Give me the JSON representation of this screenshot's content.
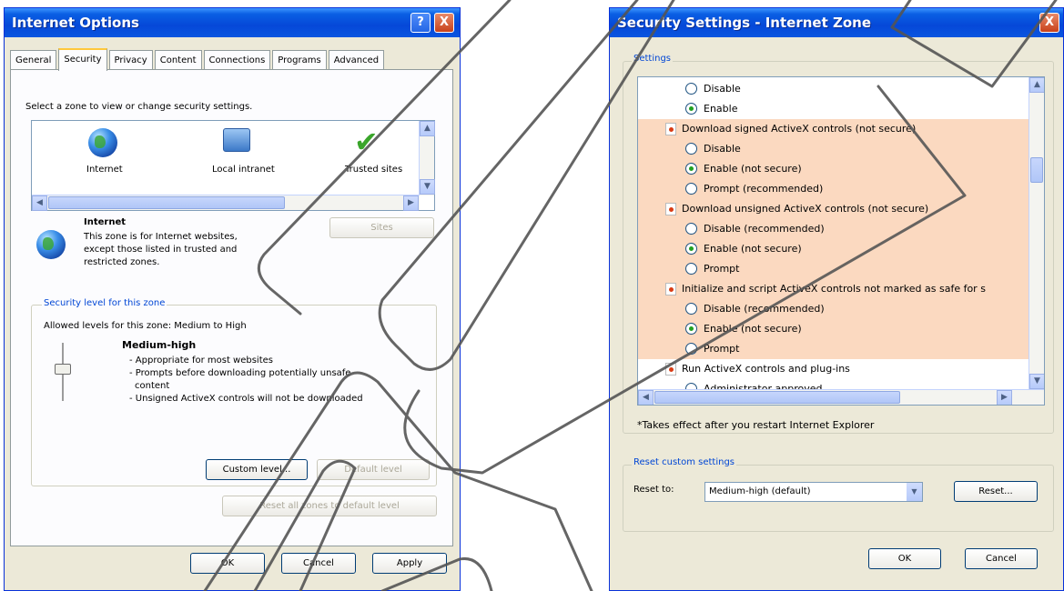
{
  "left_window": {
    "title": "Internet Options",
    "help_glyph": "?",
    "close_glyph": "X",
    "tabs": [
      "General",
      "Security",
      "Privacy",
      "Content",
      "Connections",
      "Programs",
      "Advanced"
    ],
    "active_tab": "Security",
    "zone_prompt": "Select a zone to view or change security settings.",
    "zones": [
      {
        "label": "Internet",
        "icon": "globe-icon"
      },
      {
        "label": "Local intranet",
        "icon": "computer-globe-icon"
      },
      {
        "label": "Trusted sites",
        "icon": "checkmark-icon"
      }
    ],
    "selected_zone_title": "Internet",
    "selected_zone_desc": [
      "This zone is for Internet websites,",
      "except those listed in trusted and",
      "restricted zones."
    ],
    "sites_button": "Sites",
    "level_group_label": "Security level for this zone",
    "allowed_levels": "Allowed levels for this zone: Medium to High",
    "level_name": "Medium-high",
    "level_desc": [
      "- Appropriate for most websites",
      "- Prompts before downloading potentially unsafe",
      "content",
      "- Unsigned ActiveX controls will not be downloaded"
    ],
    "custom_level_button": "Custom level...",
    "default_level_button": "Default level",
    "reset_all_button": "Reset all zones to default level",
    "ok_button": "OK",
    "cancel_button": "Cancel",
    "apply_button": "Apply"
  },
  "right_window": {
    "title": "Security Settings - Internet Zone",
    "close_glyph": "X",
    "settings_label": "Settings",
    "settings_rows": [
      {
        "type": "radio",
        "label": "Disable",
        "checked": false,
        "hl": false
      },
      {
        "type": "radio",
        "label": "Enable",
        "checked": true,
        "hl": false
      },
      {
        "type": "header",
        "label": "Download signed ActiveX controls (not secure)",
        "hl": true
      },
      {
        "type": "radio",
        "label": "Disable",
        "checked": false,
        "hl": true
      },
      {
        "type": "radio",
        "label": "Enable (not secure)",
        "checked": true,
        "hl": true
      },
      {
        "type": "radio",
        "label": "Prompt (recommended)",
        "checked": false,
        "hl": true
      },
      {
        "type": "header",
        "label": "Download unsigned ActiveX controls (not secure)",
        "hl": true
      },
      {
        "type": "radio",
        "label": "Disable (recommended)",
        "checked": false,
        "hl": true
      },
      {
        "type": "radio",
        "label": "Enable (not secure)",
        "checked": true,
        "hl": true
      },
      {
        "type": "radio",
        "label": "Prompt",
        "checked": false,
        "hl": true
      },
      {
        "type": "header",
        "label": "Initialize and script ActiveX controls not marked as safe for s",
        "hl": true
      },
      {
        "type": "radio",
        "label": "Disable (recommended)",
        "checked": false,
        "hl": true
      },
      {
        "type": "radio",
        "label": "Enable (not secure)",
        "checked": true,
        "hl": true
      },
      {
        "type": "radio",
        "label": "Prompt",
        "checked": false,
        "hl": true
      },
      {
        "type": "header",
        "label": "Run ActiveX controls and plug-ins",
        "hl": false
      },
      {
        "type": "radio",
        "label": "Administrator approved",
        "checked": false,
        "hl": false
      }
    ],
    "restart_note": "*Takes effect after you restart Internet Explorer",
    "reset_group_label": "Reset custom settings",
    "reset_to_label": "Reset to:",
    "reset_to_value": "Medium-high (default)",
    "reset_button": "Reset...",
    "ok_button": "OK",
    "cancel_button": "Cancel"
  }
}
